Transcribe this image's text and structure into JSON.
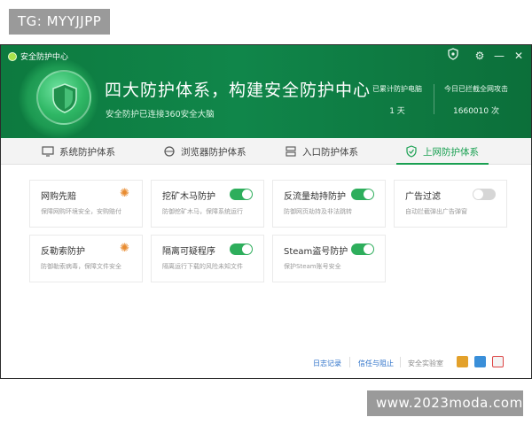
{
  "watermarks": {
    "top_left": "TG: MYYJJPP",
    "bottom_right": "www.2023moda.com"
  },
  "window": {
    "title": "安全防护中心",
    "controls": {
      "badge_icon": "shield-badge-icon",
      "settings_icon": "gear-icon",
      "minimize_icon": "minimize-icon",
      "close_icon": "close-icon",
      "minimize_glyph": "—",
      "close_glyph": "✕",
      "settings_glyph": "⚙"
    }
  },
  "header": {
    "headline": "四大防护体系，构建安全防护中心",
    "subline": "安全防护已连接360安全大脑",
    "stats": [
      {
        "label": "已累计防护电脑",
        "value": "1 天"
      },
      {
        "label": "今日已拦截全网攻击",
        "value": "1660010 次"
      }
    ]
  },
  "tabs": [
    {
      "label": "系统防护体系",
      "icon": "monitor-icon",
      "active": false
    },
    {
      "label": "浏览器防护体系",
      "icon": "browser-icon",
      "active": false
    },
    {
      "label": "入口防护体系",
      "icon": "entry-icon",
      "active": false
    },
    {
      "label": "上网防护体系",
      "icon": "shield-check-icon",
      "active": true
    }
  ],
  "cards": [
    {
      "name": "网购先赔",
      "desc": "保障网购环境安全，安购赔付",
      "control": "settings",
      "on": null
    },
    {
      "name": "挖矿木马防护",
      "desc": "防御挖矿木马，保障系统运行",
      "control": "toggle",
      "on": true
    },
    {
      "name": "反流量劫持防护",
      "desc": "防御网页劫持及非法跳转",
      "control": "toggle",
      "on": true
    },
    {
      "name": "广告过滤",
      "desc": "自动拦截弹出广告弹窗",
      "control": "toggle",
      "on": false
    },
    {
      "name": "反勒索防护",
      "desc": "防御勒索病毒，保障文件安全",
      "control": "settings",
      "on": null
    },
    {
      "name": "隔离可疑程序",
      "desc": "隔离运行下载的风险未知文件",
      "control": "toggle",
      "on": true
    },
    {
      "name": "Steam盗号防护",
      "desc": "保护Steam账号安全",
      "control": "toggle",
      "on": true
    }
  ],
  "footer": {
    "log_link": "日志记录",
    "trust_link": "信任与阻止",
    "lab_text": "安全实验室",
    "icons": [
      "toolbox-icon",
      "settings-icon",
      "report-icon"
    ]
  },
  "colors": {
    "brand_green": "#10864a",
    "accent_green": "#1aa052",
    "toggle_on": "#2eae5c",
    "toggle_off": "#d6d6d6",
    "link_blue": "#2a6fc8"
  }
}
